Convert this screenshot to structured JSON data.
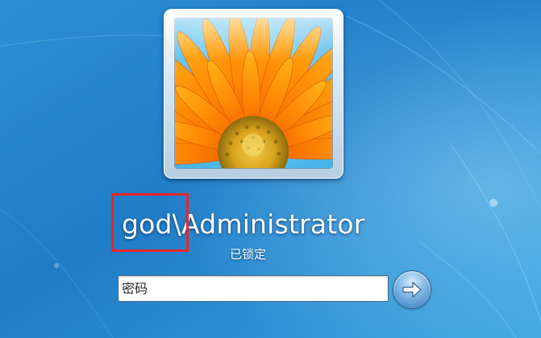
{
  "login": {
    "username": "god\\Administrator",
    "status": "已锁定",
    "password_placeholder": "密码",
    "password_value": ""
  },
  "icons": {
    "avatar": "flower-avatar-icon",
    "submit": "arrow-right-icon"
  },
  "colors": {
    "background": "#1f7cc6",
    "highlight_border": "#e8262a",
    "text": "#ffffff"
  }
}
